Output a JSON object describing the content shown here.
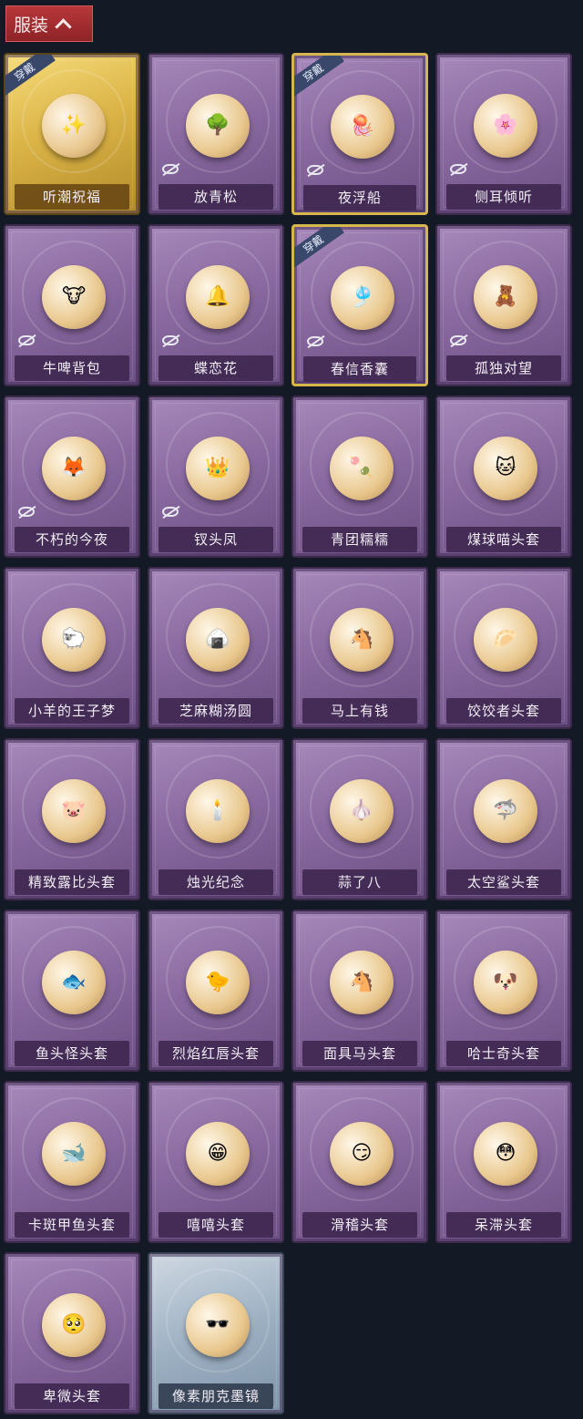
{
  "header": {
    "title": "服装",
    "toggle_icon": "chevron-up-icon",
    "bg": "#a42e31"
  },
  "items": [
    {
      "label": "听潮祝福",
      "equipped": true,
      "hidden_icon": false,
      "rarity": "gold",
      "art": "✨"
    },
    {
      "label": "放青松",
      "equipped": false,
      "hidden_icon": true,
      "rarity": "purple",
      "art": "🌳"
    },
    {
      "label": "夜浮船",
      "equipped": true,
      "hidden_icon": true,
      "rarity": "purple-gold",
      "art": "🪼"
    },
    {
      "label": "侧耳倾听",
      "equipped": false,
      "hidden_icon": true,
      "rarity": "purple",
      "art": "🌸"
    },
    {
      "label": "牛啤背包",
      "equipped": false,
      "hidden_icon": true,
      "rarity": "purple",
      "art": "🐮"
    },
    {
      "label": "蝶恋花",
      "equipped": false,
      "hidden_icon": true,
      "rarity": "purple",
      "art": "🔔"
    },
    {
      "label": "春信香囊",
      "equipped": true,
      "hidden_icon": true,
      "rarity": "purple-gold",
      "art": "🎐"
    },
    {
      "label": "孤独对望",
      "equipped": false,
      "hidden_icon": true,
      "rarity": "purple",
      "art": "🧸"
    },
    {
      "label": "不朽的今夜",
      "equipped": false,
      "hidden_icon": true,
      "rarity": "purple",
      "art": "🦊"
    },
    {
      "label": "钗头凤",
      "equipped": false,
      "hidden_icon": true,
      "rarity": "purple",
      "art": "👑"
    },
    {
      "label": "青团糯糯",
      "equipped": false,
      "hidden_icon": false,
      "rarity": "purple",
      "art": "🍡"
    },
    {
      "label": "煤球喵头套",
      "equipped": false,
      "hidden_icon": false,
      "rarity": "purple",
      "art": "🐱"
    },
    {
      "label": "小羊的王子梦",
      "equipped": false,
      "hidden_icon": false,
      "rarity": "purple",
      "art": "🐑"
    },
    {
      "label": "芝麻糊汤圆",
      "equipped": false,
      "hidden_icon": false,
      "rarity": "purple",
      "art": "🍙"
    },
    {
      "label": "马上有钱",
      "equipped": false,
      "hidden_icon": false,
      "rarity": "purple",
      "art": "🐴"
    },
    {
      "label": "饺饺者头套",
      "equipped": false,
      "hidden_icon": false,
      "rarity": "purple",
      "art": "🥟"
    },
    {
      "label": "精致露比头套",
      "equipped": false,
      "hidden_icon": false,
      "rarity": "purple",
      "art": "🐷"
    },
    {
      "label": "烛光纪念",
      "equipped": false,
      "hidden_icon": false,
      "rarity": "purple",
      "art": "🕯️"
    },
    {
      "label": "蒜了八",
      "equipped": false,
      "hidden_icon": false,
      "rarity": "purple",
      "art": "🧄"
    },
    {
      "label": "太空鲨头套",
      "equipped": false,
      "hidden_icon": false,
      "rarity": "purple",
      "art": "🦈"
    },
    {
      "label": "鱼头怪头套",
      "equipped": false,
      "hidden_icon": false,
      "rarity": "purple",
      "art": "🐟"
    },
    {
      "label": "烈焰红唇头套",
      "equipped": false,
      "hidden_icon": false,
      "rarity": "purple",
      "art": "🐤"
    },
    {
      "label": "面具马头套",
      "equipped": false,
      "hidden_icon": false,
      "rarity": "purple",
      "art": "🐴"
    },
    {
      "label": "哈士奇头套",
      "equipped": false,
      "hidden_icon": false,
      "rarity": "purple",
      "art": "🐶"
    },
    {
      "label": "卡斑甲鱼头套",
      "equipped": false,
      "hidden_icon": false,
      "rarity": "purple",
      "art": "🐋"
    },
    {
      "label": "嘻嘻头套",
      "equipped": false,
      "hidden_icon": false,
      "rarity": "purple",
      "art": "😁"
    },
    {
      "label": "滑稽头套",
      "equipped": false,
      "hidden_icon": false,
      "rarity": "purple",
      "art": "😏"
    },
    {
      "label": "呆滞头套",
      "equipped": false,
      "hidden_icon": false,
      "rarity": "purple",
      "art": "😳"
    },
    {
      "label": "卑微头套",
      "equipped": false,
      "hidden_icon": false,
      "rarity": "purple",
      "art": "🥺"
    },
    {
      "label": "像素朋克墨镜",
      "equipped": false,
      "hidden_icon": false,
      "rarity": "silver",
      "art": "🕶️"
    }
  ],
  "equip_badge_text": "穿戴"
}
